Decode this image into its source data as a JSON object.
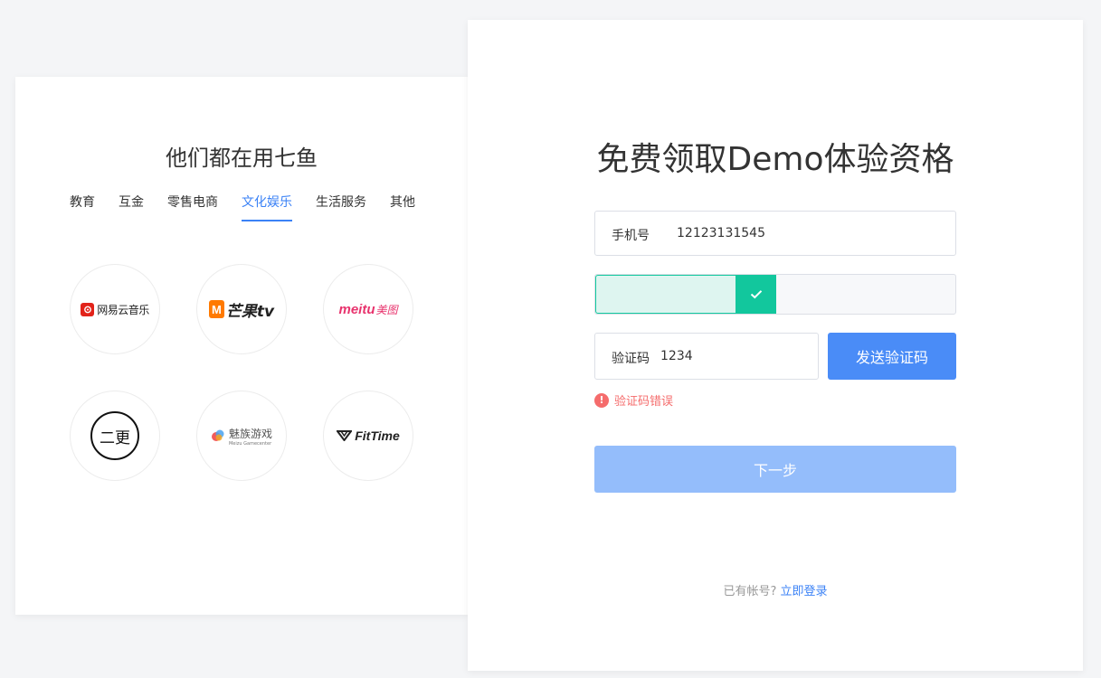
{
  "left": {
    "title": "他们都在用七鱼",
    "tabs": [
      {
        "label": "教育",
        "active": false
      },
      {
        "label": "互金",
        "active": false
      },
      {
        "label": "零售电商",
        "active": false
      },
      {
        "label": "文化娱乐",
        "active": true
      },
      {
        "label": "生活服务",
        "active": false
      },
      {
        "label": "其他",
        "active": false
      }
    ],
    "logos": [
      {
        "name": "网易云音乐",
        "icon": "netease-music-icon"
      },
      {
        "name": "芒果tv",
        "icon": "mango-tv-icon"
      },
      {
        "brand": "meitu",
        "name": "美图",
        "icon": "meitu-icon"
      },
      {
        "name": "二更",
        "icon": "ergeng-icon"
      },
      {
        "name": "魅族游戏",
        "subtitle": "Meizu Gamecenter",
        "icon": "meizu-game-icon"
      },
      {
        "name": "FitTime",
        "icon": "fittime-icon"
      }
    ]
  },
  "form": {
    "title": "免费领取Demo体验资格",
    "phone_label": "手机号",
    "phone_value": "12123131545",
    "slider_progress": 0.44,
    "code_label": "验证码",
    "code_value": "1234",
    "send_code_label": "发送验证码",
    "error_text": "验证码错误",
    "next_label": "下一步",
    "footer_text": "已有帐号?",
    "footer_link": "立即登录"
  },
  "colors": {
    "accent": "#4a8cf7",
    "slider_green": "#12c79d",
    "error": "#f56c6c"
  }
}
